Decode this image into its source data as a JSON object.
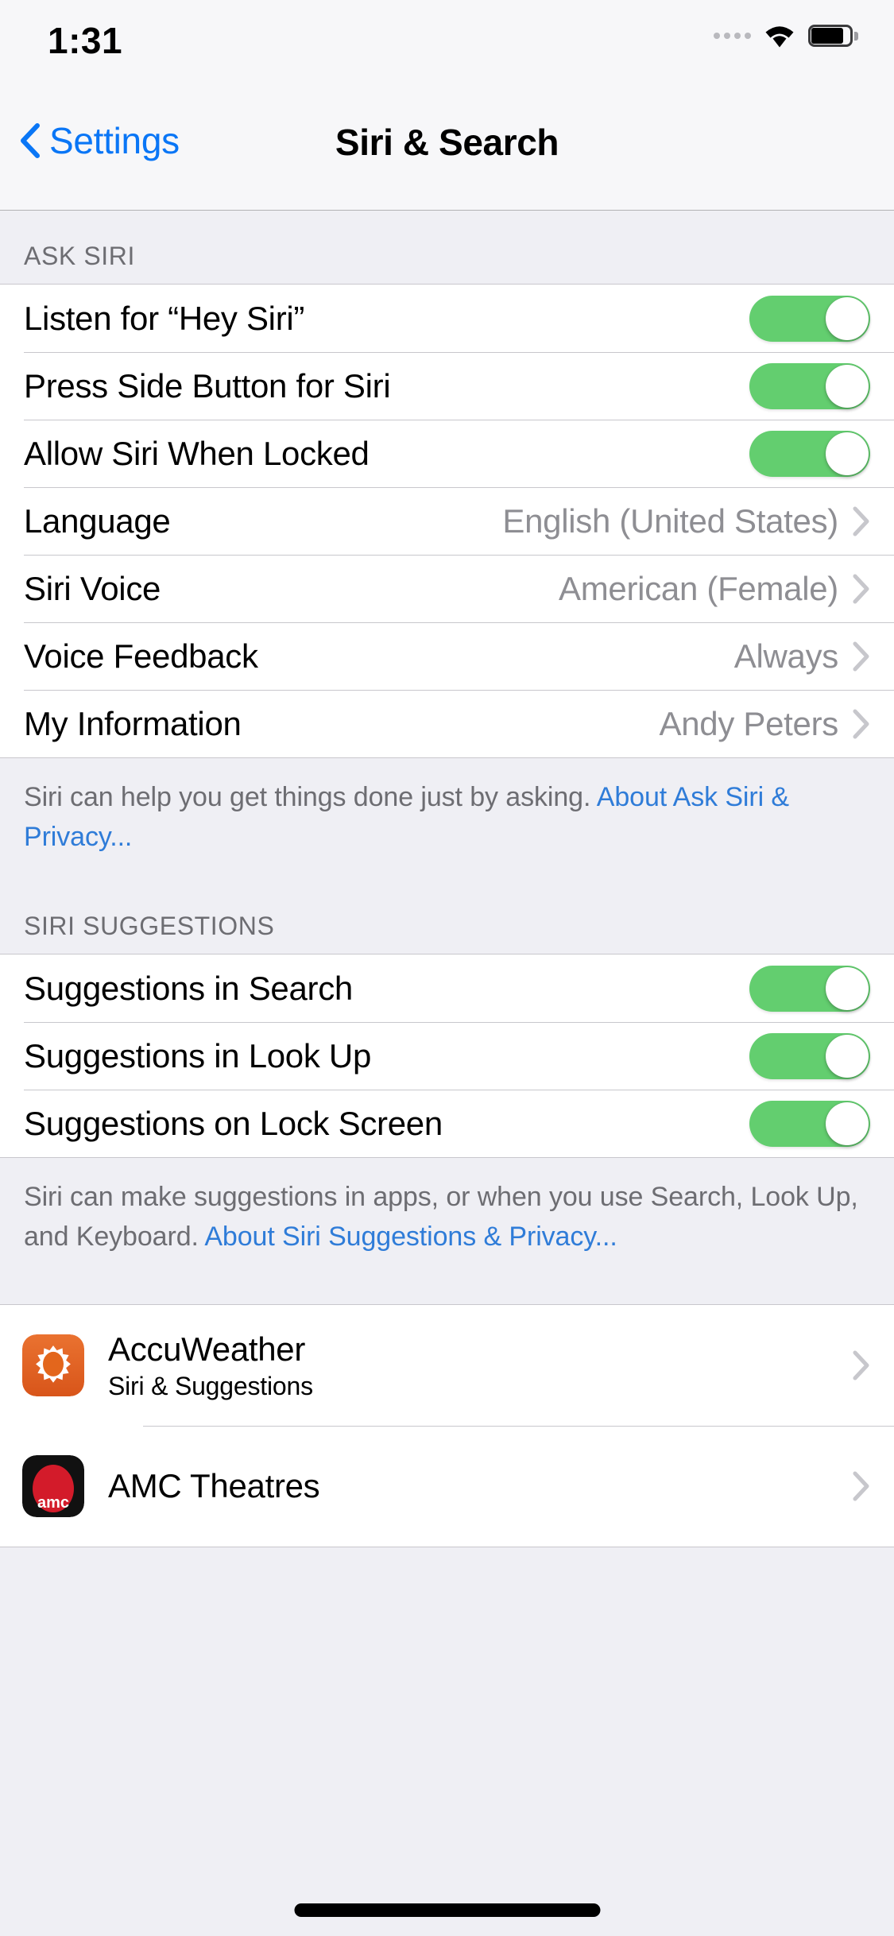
{
  "status_bar": {
    "time": "1:31",
    "signal_icon": "signal-dots-icon",
    "wifi_icon": "wifi-icon",
    "battery_icon": "battery-full-icon"
  },
  "nav": {
    "back_icon": "chevron-left-icon",
    "back_label": "Settings",
    "title": "Siri & Search"
  },
  "sections": {
    "ask_siri": {
      "header": "ASK SIRI",
      "rows": [
        {
          "label": "Listen for “Hey Siri”",
          "type": "toggle",
          "on": true
        },
        {
          "label": "Press Side Button for Siri",
          "type": "toggle",
          "on": true
        },
        {
          "label": "Allow Siri When Locked",
          "type": "toggle",
          "on": true
        },
        {
          "label": "Language",
          "type": "disclosure",
          "value": "English (United States)"
        },
        {
          "label": "Siri Voice",
          "type": "disclosure",
          "value": "American (Female)"
        },
        {
          "label": "Voice Feedback",
          "type": "disclosure",
          "value": "Always"
        },
        {
          "label": "My Information",
          "type": "disclosure",
          "value": "Andy Peters"
        }
      ],
      "footer_text": "Siri can help you get things done just by asking. ",
      "footer_link": "About Ask Siri & Privacy..."
    },
    "siri_suggestions": {
      "header": "SIRI SUGGESTIONS",
      "rows": [
        {
          "label": "Suggestions in Search",
          "type": "toggle",
          "on": true
        },
        {
          "label": "Suggestions in Look Up",
          "type": "toggle",
          "on": true
        },
        {
          "label": "Suggestions on Lock Screen",
          "type": "toggle",
          "on": true
        }
      ],
      "footer_text": "Siri can make suggestions in apps, or when you use Search, Look Up, and Keyboard. ",
      "footer_link": "About Siri Suggestions & Privacy..."
    },
    "apps": {
      "rows": [
        {
          "name": "AccuWeather",
          "subtitle": "Siri & Suggestions",
          "icon": "accuweather-app-icon",
          "icon_color": "#E3661C"
        },
        {
          "name": "AMC Theatres",
          "subtitle": "",
          "icon": "amc-theatres-app-icon",
          "icon_color": "#D31B2A"
        }
      ]
    }
  },
  "colors": {
    "accent_blue": "#0A76F6",
    "link_blue": "#2F7CD8",
    "toggle_on_green": "#63CE6F",
    "group_background": "#EFEFF4",
    "secondary_text": "#8E8E93",
    "header_text": "#6D6D72"
  },
  "home_indicator": "home-indicator-bar"
}
